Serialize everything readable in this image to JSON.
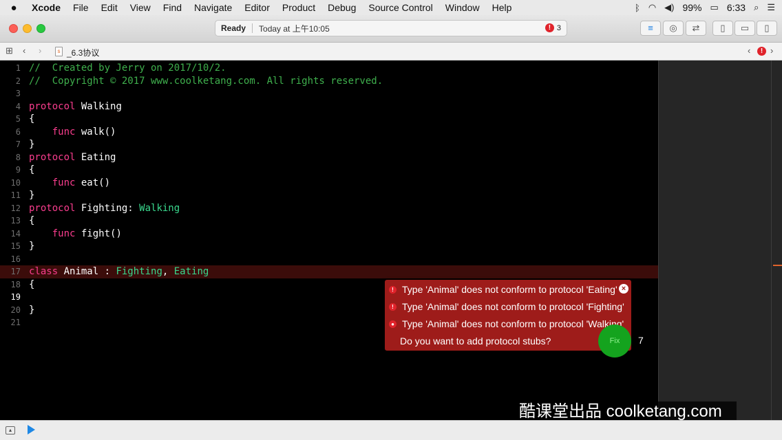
{
  "menubar": {
    "apple": "",
    "items": [
      "Xcode",
      "File",
      "Edit",
      "View",
      "Find",
      "Navigate",
      "Editor",
      "Product",
      "Debug",
      "Source Control",
      "Window",
      "Help"
    ],
    "battery": "99%",
    "time": "6:33"
  },
  "toolbar": {
    "status": "Ready",
    "timestamp": "Today at 上午10:05",
    "error_count": "3"
  },
  "jumpbar": {
    "filename": "_6.3协议"
  },
  "editor": {
    "lines": [
      {
        "n": "1",
        "parts": [
          {
            "t": "//  Created by Jerry on 2017/10/2.",
            "c": "cm"
          }
        ]
      },
      {
        "n": "2",
        "parts": [
          {
            "t": "//  Copyright © 2017 www.coolketang.com. All rights reserved.",
            "c": "cm"
          }
        ]
      },
      {
        "n": "3",
        "parts": []
      },
      {
        "n": "4",
        "parts": [
          {
            "t": "protocol",
            "c": "kw"
          },
          {
            "t": " Walking",
            "c": "pl"
          }
        ]
      },
      {
        "n": "5",
        "parts": [
          {
            "t": "{",
            "c": "pl"
          }
        ]
      },
      {
        "n": "6",
        "parts": [
          {
            "t": "    ",
            "c": "pl"
          },
          {
            "t": "func",
            "c": "kw"
          },
          {
            "t": " walk()",
            "c": "pl"
          }
        ]
      },
      {
        "n": "7",
        "parts": [
          {
            "t": "}",
            "c": "pl"
          }
        ]
      },
      {
        "n": "8",
        "parts": [
          {
            "t": "protocol",
            "c": "kw"
          },
          {
            "t": " Eating",
            "c": "pl"
          }
        ]
      },
      {
        "n": "9",
        "parts": [
          {
            "t": "{",
            "c": "pl"
          }
        ]
      },
      {
        "n": "10",
        "parts": [
          {
            "t": "    ",
            "c": "pl"
          },
          {
            "t": "func",
            "c": "kw"
          },
          {
            "t": " eat()",
            "c": "pl"
          }
        ]
      },
      {
        "n": "11",
        "parts": [
          {
            "t": "}",
            "c": "pl"
          }
        ]
      },
      {
        "n": "12",
        "parts": [
          {
            "t": "protocol",
            "c": "kw"
          },
          {
            "t": " Fighting: ",
            "c": "pl"
          },
          {
            "t": "Walking",
            "c": "ty"
          }
        ]
      },
      {
        "n": "13",
        "parts": [
          {
            "t": "{",
            "c": "pl"
          }
        ]
      },
      {
        "n": "14",
        "parts": [
          {
            "t": "    ",
            "c": "pl"
          },
          {
            "t": "func",
            "c": "kw"
          },
          {
            "t": " fight()",
            "c": "pl"
          }
        ]
      },
      {
        "n": "15",
        "parts": [
          {
            "t": "}",
            "c": "pl"
          }
        ]
      },
      {
        "n": "16",
        "parts": []
      },
      {
        "n": "17",
        "parts": [
          {
            "t": "class",
            "c": "kw"
          },
          {
            "t": " Animal : ",
            "c": "pl"
          },
          {
            "t": "Fighting",
            "c": "ty"
          },
          {
            "t": ", ",
            "c": "pl"
          },
          {
            "t": "Eating",
            "c": "ty"
          }
        ],
        "error": true
      },
      {
        "n": "18",
        "parts": [
          {
            "t": "{",
            "c": "pl"
          }
        ]
      },
      {
        "n": "19",
        "parts": [],
        "current": true
      },
      {
        "n": "20",
        "parts": [
          {
            "t": "}",
            "c": "pl"
          }
        ]
      },
      {
        "n": "21",
        "parts": []
      }
    ]
  },
  "popup": {
    "errors": [
      "Type 'Animal' does not conform to protocol 'Eating'",
      "Type 'Animal' does not conform to protocol 'Fighting'",
      "Type 'Animal' does not conform to protocol 'Walking'"
    ],
    "question": "Do you want to add protocol stubs?",
    "fix_label": "Fix",
    "fix_count": "7"
  },
  "watermark": "酷课堂出品 coolketang.com",
  "colors": {
    "comment": "#3fb04d",
    "keyword": "#fa3d8e",
    "type": "#3ad98e",
    "error_bg": "#9e1c1a",
    "fix_button": "#14a31e"
  }
}
